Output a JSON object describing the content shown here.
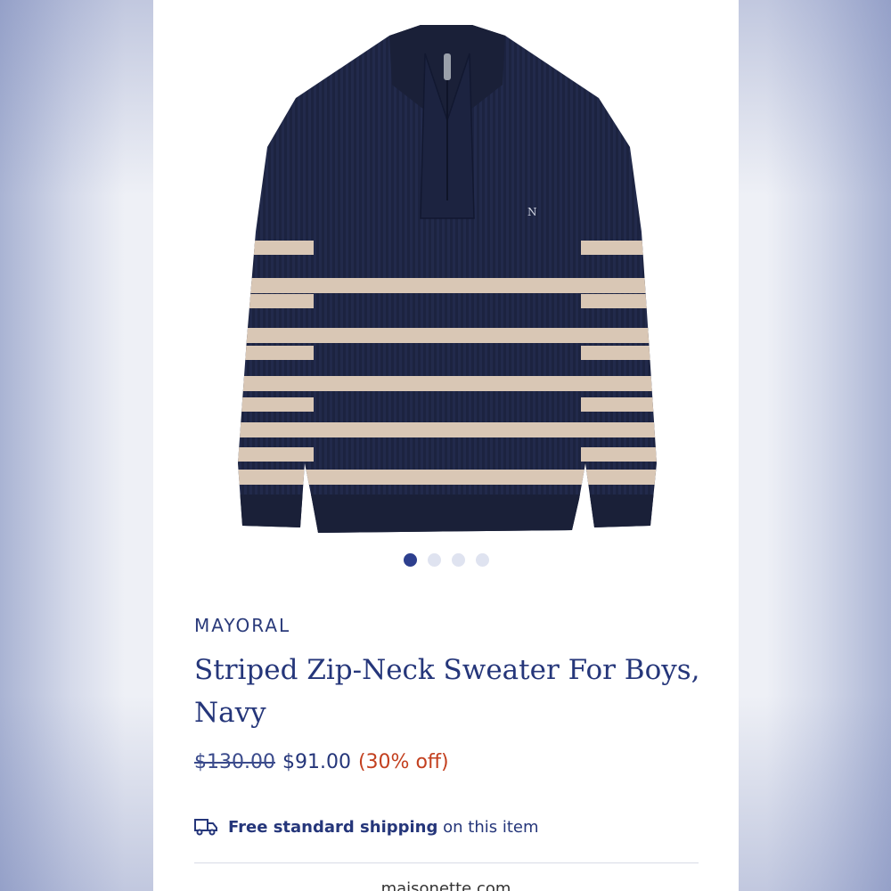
{
  "product": {
    "brand": "MAYORAL",
    "title": "Striped Zip-Neck Sweater For Boys, Navy",
    "original_price": "$130.00",
    "sale_price": "$91.00",
    "discount": "(30% off)"
  },
  "carousel": {
    "total": 4,
    "active_index": 0
  },
  "shipping": {
    "bold_text": "Free standard shipping",
    "rest_text": "on this item",
    "icon": "truck-icon"
  },
  "footer": {
    "url": "maisonette.com"
  },
  "colors": {
    "navy": "#1c2340",
    "stripe": "#d9c7b5",
    "accent": "#25367a",
    "discount": "#c3401f"
  }
}
